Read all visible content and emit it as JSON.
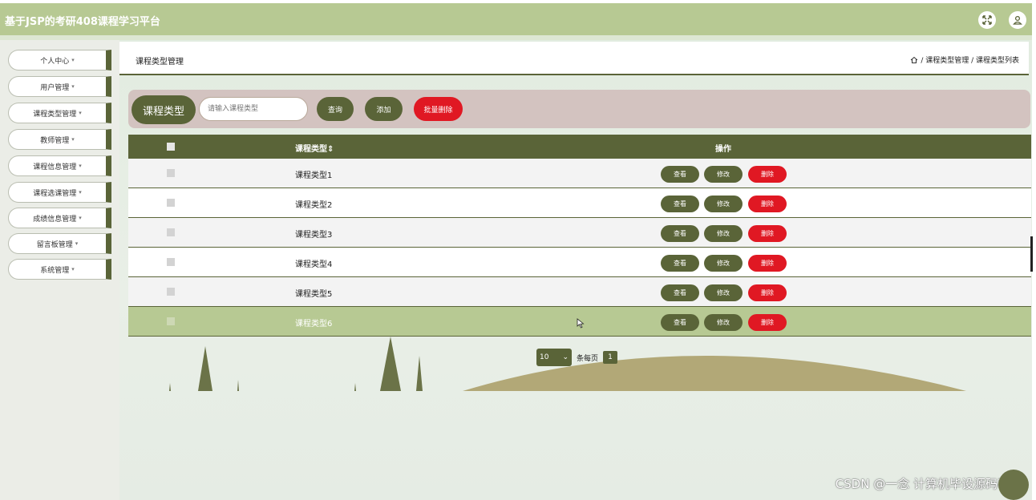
{
  "header": {
    "app_title": "基于JSP的考研408课程学习平台",
    "icons": [
      "fullscreen-icon",
      "user-icon"
    ]
  },
  "sidebar": {
    "items": [
      {
        "label": "个人中心"
      },
      {
        "label": "用户管理"
      },
      {
        "label": "课程类型管理"
      },
      {
        "label": "教师管理"
      },
      {
        "label": "课程信息管理"
      },
      {
        "label": "课程选课管理"
      },
      {
        "label": "成绩信息管理"
      },
      {
        "label": "留言板管理"
      },
      {
        "label": "系统管理"
      }
    ]
  },
  "breadcrumb": {
    "page_title": "课程类型管理",
    "trail": "/ 课程类型管理 / 课程类型列表"
  },
  "search": {
    "label": "课程类型",
    "placeholder": "请输入课程类型",
    "query_button": "查询",
    "add_button": "添加",
    "batch_delete_button": "批量删除"
  },
  "table": {
    "col_name": "课程类型",
    "col_actions": "操作",
    "rows": [
      {
        "name": "课程类型1"
      },
      {
        "name": "课程类型2"
      },
      {
        "name": "课程类型3"
      },
      {
        "name": "课程类型4"
      },
      {
        "name": "课程类型5"
      },
      {
        "name": "课程类型6"
      }
    ],
    "action_view": "查看",
    "action_edit": "修改",
    "action_delete": "删除"
  },
  "pagination": {
    "page_size": "10",
    "per_page_label": "条每页",
    "current_page": "1"
  },
  "watermark": "CSDN @一念 计算机毕设源码程序",
  "colors": {
    "accent": "#5a6438",
    "header": "#b7c993",
    "danger": "#e01823",
    "search_panel": "#d3c3c0"
  }
}
